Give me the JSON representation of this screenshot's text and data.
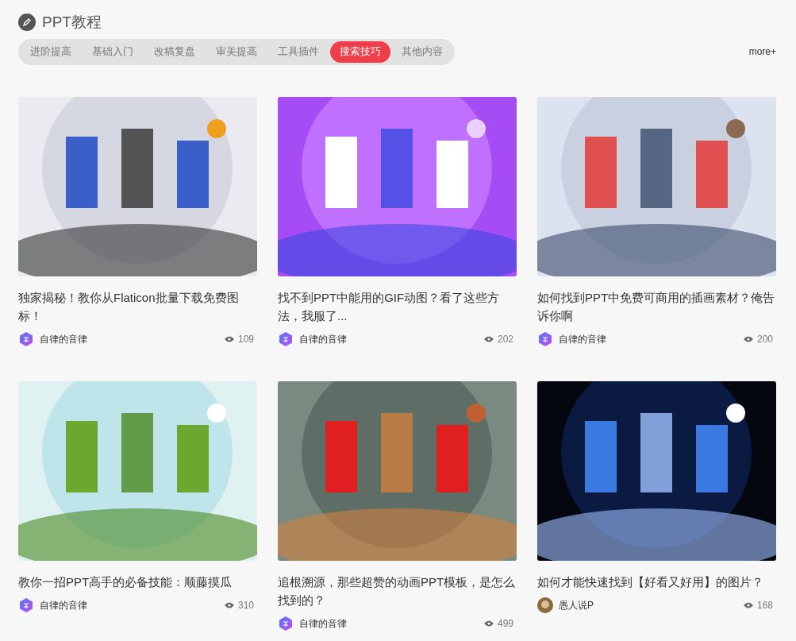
{
  "header": {
    "title": "PPT教程"
  },
  "tabs": [
    {
      "label": "进阶提高",
      "selected": false
    },
    {
      "label": "基础入门",
      "selected": false
    },
    {
      "label": "改稿复盘",
      "selected": false
    },
    {
      "label": "审美提高",
      "selected": false
    },
    {
      "label": "工具插件",
      "selected": false
    },
    {
      "label": "搜索技巧",
      "selected": true
    },
    {
      "label": "其他内容",
      "selected": false
    }
  ],
  "more_link": "more+",
  "articles": [
    {
      "title": "独家揭秘！教你从Flaticon批量下载免费图标！",
      "author": "自律的音律",
      "avatar": {
        "kind": "badge"
      },
      "views": "109"
    },
    {
      "title": "找不到PPT中能用的GIF动图？看了这些方法，我服了...",
      "author": "自律的音律",
      "avatar": {
        "kind": "badge"
      },
      "views": "202"
    },
    {
      "title": "如何找到PPT中免费可商用的插画素材？俺告诉你啊",
      "author": "自律的音律",
      "avatar": {
        "kind": "badge"
      },
      "views": "200"
    },
    {
      "title": "教你一招PPT高手的必备技能：顺藤摸瓜",
      "author": "自律的音律",
      "avatar": {
        "kind": "badge"
      },
      "views": "310"
    },
    {
      "title": "追根溯源，那些超赞的动画PPT模板，是怎么找到的？",
      "author": "自律的音律",
      "avatar": {
        "kind": "badge"
      },
      "views": "499"
    },
    {
      "title": "如何才能快速找到【好看又好用】的图片？",
      "author": "愚人说P",
      "views": "168"
    }
  ]
}
